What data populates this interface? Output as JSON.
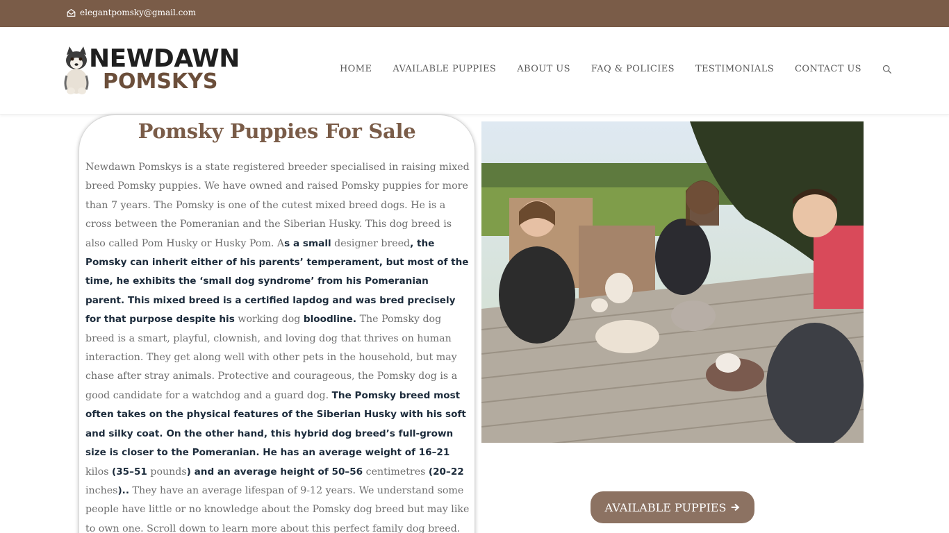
{
  "topbar": {
    "email": "elegantpomsky@gmail.com",
    "icon": "envelope-icon"
  },
  "logo": {
    "line1": "NEWDAWN",
    "line2": "POMSKYS"
  },
  "nav": {
    "items": [
      "HOME",
      "AVAILABLE PUPPIES",
      "ABOUT US",
      "FAQ & POLICIES",
      "TESTIMONIALS",
      "CONTACT US"
    ],
    "search_icon": "search-icon"
  },
  "main": {
    "title": "Pomsky Puppies For Sale",
    "segments": [
      "Newdawn Pomskys is a state registered breeder specialised in raising mixed breed Pomsky puppies. We have owned and raised Pomsky puppies for more than 7 years. The Pomsky is one of the cutest mixed breed dogs. He is a cross between the Pomeranian and the Siberian Husky. This dog breed is also called Pom Husky or Husky Pom. A",
      "s a small",
      " designer breed",
      ", the Pomsky can inherit either of his parents’ temperament, but most of the time, he exhibits the ‘small dog syndrome’ from his Pomeranian parent. This mixed breed is a certified lapdog and was bred precisely for that purpose despite his",
      " working dog ",
      "bloodline.",
      " The Pomsky dog breed is a smart, playful, clownish, and loving dog that thrives on human interaction. They get along well with other pets in the household, but may chase after stray animals. Protective and courageous, the Pomsky dog is a good candidate for a watchdog and a guard dog. ",
      "The Pomsky breed most often takes on the physical features of the Siberian Husky with his soft and silky coat. On the other hand, this hybrid dog breed’s full-grown size is closer to the Pomeranian. He has an average weight of 16–21",
      " kilos ",
      "(35–51",
      " pounds",
      ") and an average height of 50–56",
      " centimetres ",
      "(20–22",
      " inches",
      ")..",
      " They have an average lifespan of 9-12 years.  We understand some people have little or no knowledge about the Pomsky dog breed but may like to own one. Scroll down to learn more about this perfect family dog breed."
    ]
  },
  "cta": {
    "label": "AVAILABLE PUPPIES",
    "icon": "arrow-right-icon"
  },
  "colors": {
    "topbar": "#7a5c48",
    "title": "#7a5c48",
    "button": "#8c7262"
  }
}
